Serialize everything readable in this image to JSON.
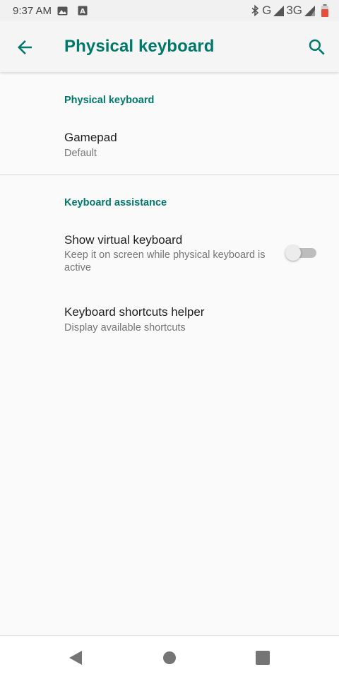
{
  "status_bar": {
    "time": "9:37 AM",
    "network_1": "G",
    "network_2": "3G",
    "icons": [
      "image-icon",
      "a-icon",
      "bluetooth-icon",
      "signal-icon",
      "battery-icon"
    ],
    "battery_color": "#e74c3c"
  },
  "app_bar": {
    "title": "Physical keyboard",
    "accent_color": "#00796b"
  },
  "sections": {
    "physical_keyboard": {
      "header": "Physical keyboard",
      "gamepad": {
        "title": "Gamepad",
        "summary": "Default"
      }
    },
    "keyboard_assistance": {
      "header": "Keyboard assistance",
      "show_virtual_keyboard": {
        "title": "Show virtual keyboard",
        "summary": "Keep it on screen while physical keyboard is active",
        "enabled": false
      },
      "shortcuts_helper": {
        "title": "Keyboard shortcuts helper",
        "summary": "Display available shortcuts"
      }
    }
  },
  "nav_bar": {
    "buttons": [
      "back-icon",
      "home-icon",
      "recents-icon"
    ]
  }
}
